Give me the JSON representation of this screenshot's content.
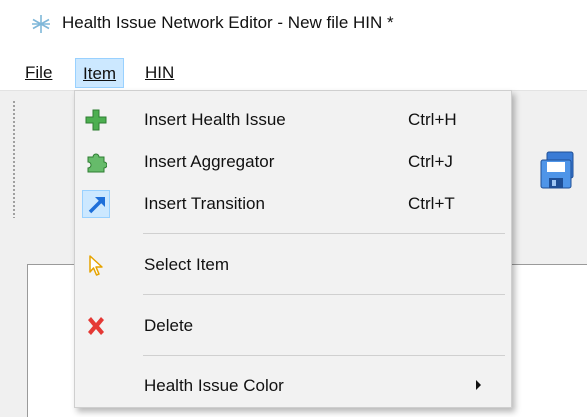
{
  "window": {
    "title": "Health Issue Network Editor - New file HIN *",
    "app_icon": "snowflake-network-icon"
  },
  "menubar": {
    "items": [
      {
        "label": "File",
        "active": false
      },
      {
        "label": "Item",
        "active": true
      },
      {
        "label": "HIN",
        "active": false
      }
    ]
  },
  "toolbar": {
    "save_icon": "save-floppy-icon"
  },
  "item_menu": {
    "entries": [
      {
        "label": "Insert Health Issue",
        "shortcut": "Ctrl+H",
        "icon": "green-plus-icon"
      },
      {
        "label": "Insert Aggregator",
        "shortcut": "Ctrl+J",
        "icon": "green-puzzle-icon"
      },
      {
        "label": "Insert Transition",
        "shortcut": "Ctrl+T",
        "icon": "blue-arrow-icon",
        "checked": true
      },
      {
        "label": "Select Item",
        "shortcut": "",
        "icon": "cursor-pointer-icon"
      },
      {
        "label": "Delete",
        "shortcut": "",
        "icon": "red-x-icon"
      },
      {
        "label": "Health Issue Color",
        "shortcut": "",
        "icon": "",
        "has_submenu": true
      }
    ]
  },
  "colors": {
    "menu_highlight": "#cce8ff",
    "menu_highlight_border": "#99d1ff",
    "menu_background": "#f2f2f2",
    "toolbar_background": "#f0f0f0"
  }
}
